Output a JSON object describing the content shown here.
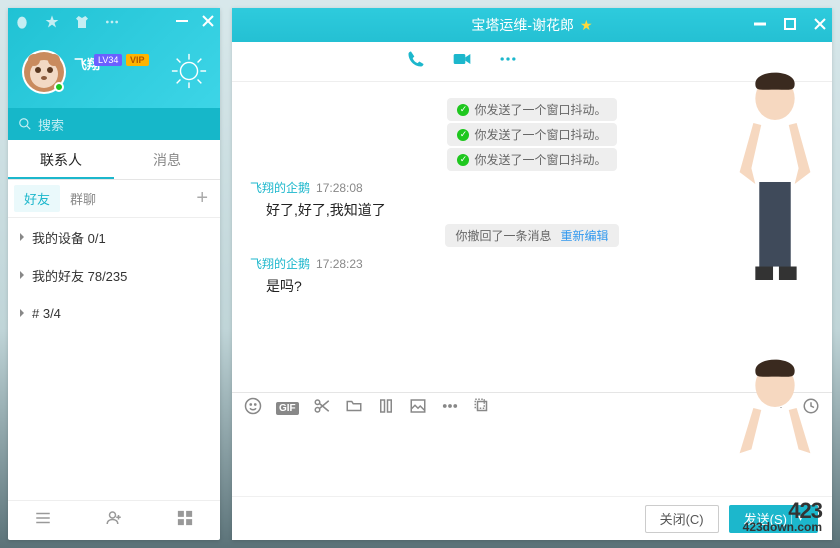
{
  "leftPanel": {
    "nickname": "飞翔",
    "lvBadge": "LV34",
    "vipBadge": "VIP",
    "searchPlaceholder": "搜索",
    "tabs": {
      "contacts": "联系人",
      "messages": "消息"
    },
    "subtabs": {
      "friends": "好友",
      "groups": "群聊"
    },
    "items": [
      {
        "label": "我的设备 0/1"
      },
      {
        "label": "我的好友 78/235"
      },
      {
        "label": "# 3/4"
      }
    ]
  },
  "chat": {
    "title": "宝塔运维-谢花郎",
    "sysNudge": "你发送了一个窗口抖动。",
    "msgs": [
      {
        "sender": "飞翔的企鹅",
        "time": "17:28:08",
        "text": "好了,好了,我知道了"
      },
      {
        "sender": "飞翔的企鹅",
        "time": "17:28:23",
        "text": "是吗?"
      }
    ],
    "recall": {
      "text": "你撤回了一条消息",
      "link": "重新编辑"
    },
    "gif": "GIF",
    "closeBtn": "关闭(C)",
    "sendBtn": "发送(S)"
  },
  "watermark": {
    "big": "423",
    "url": "423down.com"
  }
}
